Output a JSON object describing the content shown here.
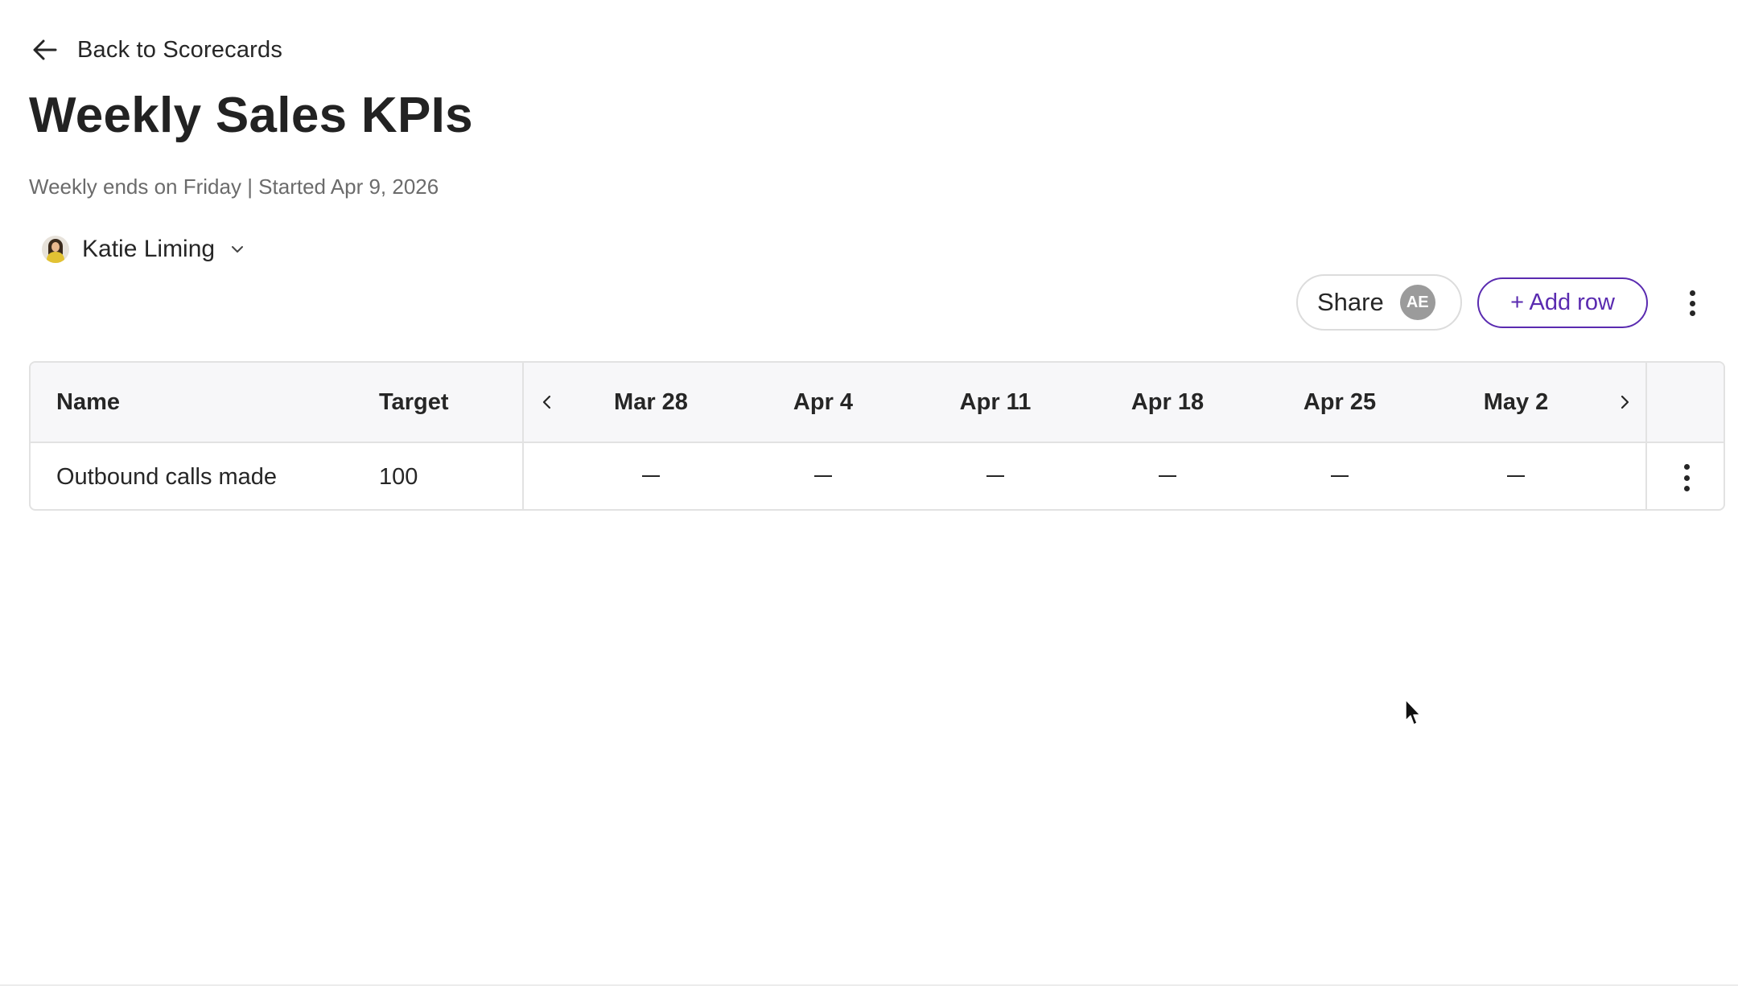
{
  "nav": {
    "back_label": "Back to Scorecards"
  },
  "page": {
    "title": "Weekly Sales KPIs",
    "subtitle": "Weekly ends on Friday | Started Apr 9, 2026"
  },
  "owner": {
    "name": "Katie Liming"
  },
  "actions": {
    "share_label": "Share",
    "share_avatar_initials": "AE",
    "add_row_label": "+ Add row"
  },
  "table": {
    "columns": {
      "name": "Name",
      "target": "Target",
      "weeks": [
        "Mar 28",
        "Apr 4",
        "Apr 11",
        "Apr 18",
        "Apr 25",
        "May 2"
      ]
    },
    "rows": [
      {
        "name": "Outbound calls made",
        "target": "100",
        "values": [
          "—",
          "—",
          "—",
          "—",
          "—",
          "—"
        ]
      }
    ]
  },
  "colors": {
    "accent": "#5a2bb0",
    "text": "#262626",
    "muted": "#6b6b6b",
    "header_bg": "#f7f7f9",
    "border": "#e2e2e2",
    "avatar_gray": "#9b9b9b"
  }
}
